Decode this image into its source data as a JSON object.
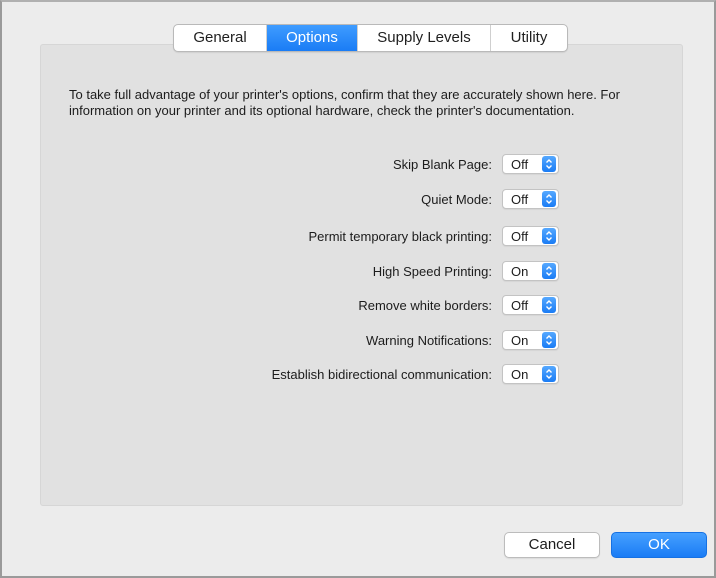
{
  "tabs": [
    {
      "label": "General",
      "active": false
    },
    {
      "label": "Options",
      "active": true
    },
    {
      "label": "Supply Levels",
      "active": false
    },
    {
      "label": "Utility",
      "active": false
    }
  ],
  "description": "To take full advantage of your printer's options, confirm that they are accurately shown here. For information on your printer and its optional hardware, check the printer's documentation.",
  "options": [
    {
      "label": "Skip Blank Page:",
      "value": "Off"
    },
    {
      "label": "Quiet Mode:",
      "value": "Off"
    },
    {
      "label": "Permit temporary black printing:",
      "value": "Off"
    },
    {
      "label": "High Speed Printing:",
      "value": "On"
    },
    {
      "label": "Remove white borders:",
      "value": "Off"
    },
    {
      "label": "Warning Notifications:",
      "value": "On"
    },
    {
      "label": "Establish bidirectional communication:",
      "value": "On"
    }
  ],
  "buttons": {
    "cancel": "Cancel",
    "ok": "OK"
  },
  "colors": {
    "accent": "#1a7cf5",
    "panel_background": "#e1e1e1",
    "window_background": "#ececec"
  },
  "icons": {
    "popup_arrows": "chevron-up-down-icon"
  }
}
